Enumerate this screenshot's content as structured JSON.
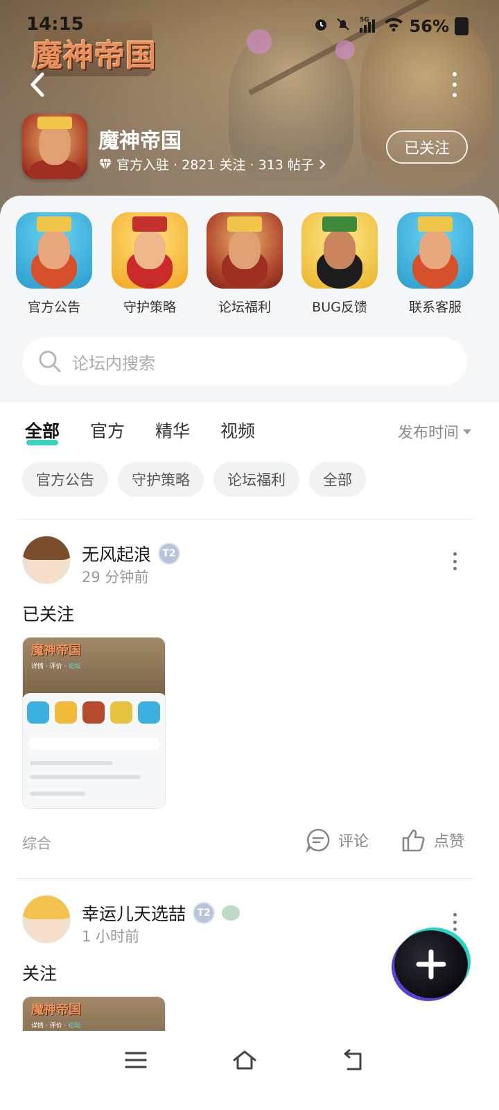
{
  "status_bar": {
    "time": "14:15",
    "network": "5G",
    "battery": "56%"
  },
  "header": {
    "logo_text": "魔神帝国",
    "game_name": "魔神帝国",
    "stats": "官方入驻 · 2821 关注 · 313 帖子",
    "follow_button": "已关注"
  },
  "shortcuts": [
    {
      "label": "官方公告"
    },
    {
      "label": "守护策略"
    },
    {
      "label": "论坛福利"
    },
    {
      "label": "BUG反馈"
    },
    {
      "label": "联系客服"
    }
  ],
  "search": {
    "placeholder": "论坛内搜索"
  },
  "tabs": [
    {
      "label": "全部",
      "active": true
    },
    {
      "label": "官方",
      "active": false
    },
    {
      "label": "精华",
      "active": false
    },
    {
      "label": "视频",
      "active": false
    }
  ],
  "sort_label": "发布时间",
  "chips": [
    "官方公告",
    "守护策略",
    "论坛福利",
    "全部"
  ],
  "posts": [
    {
      "username": "无风起浪",
      "level_badge": "T2",
      "time": "29 分钟前",
      "title": "已关注",
      "category": "综合",
      "comment_label": "评论",
      "like_label": "点赞",
      "thumbnail": {
        "logo": "魔神帝国",
        "nav_tabs": [
          "详情",
          "评价",
          "论坛"
        ]
      }
    },
    {
      "username": "幸运儿天选喆",
      "level_badge": "T2",
      "time": "1 小时前",
      "title": "关注",
      "thumbnail": {
        "logo": "魔神帝国",
        "nav_tabs": [
          "详情",
          "评价",
          "论坛"
        ]
      }
    }
  ],
  "colors": {
    "accent": "#3ad3c2",
    "fab_purple": "#5b3fd8",
    "fab_teal": "#22d3c6"
  }
}
